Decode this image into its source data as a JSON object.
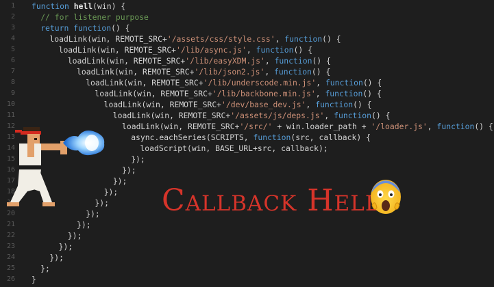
{
  "editor": {
    "lines": [
      {
        "n": "1",
        "indent": 0,
        "tokens": [
          {
            "c": "kw",
            "t": "function "
          },
          {
            "c": "fn",
            "t": "hell"
          },
          {
            "c": "pl",
            "t": "(win) {"
          }
        ]
      },
      {
        "n": "2",
        "indent": 1,
        "tokens": [
          {
            "c": "cm",
            "t": "// for listener purpose"
          }
        ]
      },
      {
        "n": "3",
        "indent": 1,
        "tokens": [
          {
            "c": "kw",
            "t": "return "
          },
          {
            "c": "kw",
            "t": "function"
          },
          {
            "c": "pl",
            "t": "() {"
          }
        ]
      },
      {
        "n": "4",
        "indent": 2,
        "tokens": [
          {
            "c": "pl",
            "t": "loadLink(win, REMOTE_SRC+"
          },
          {
            "c": "str",
            "t": "'/assets/css/style.css'"
          },
          {
            "c": "pl",
            "t": ", "
          },
          {
            "c": "kw",
            "t": "function"
          },
          {
            "c": "pl",
            "t": "() {"
          }
        ]
      },
      {
        "n": "5",
        "indent": 3,
        "tokens": [
          {
            "c": "pl",
            "t": "loadLink(win, REMOTE_SRC+"
          },
          {
            "c": "str",
            "t": "'/lib/async.js'"
          },
          {
            "c": "pl",
            "t": ", "
          },
          {
            "c": "kw",
            "t": "function"
          },
          {
            "c": "pl",
            "t": "() {"
          }
        ]
      },
      {
        "n": "6",
        "indent": 4,
        "tokens": [
          {
            "c": "pl",
            "t": "loadLink(win, REMOTE_SRC+"
          },
          {
            "c": "str",
            "t": "'/lib/easyXDM.js'"
          },
          {
            "c": "pl",
            "t": ", "
          },
          {
            "c": "kw",
            "t": "function"
          },
          {
            "c": "pl",
            "t": "() {"
          }
        ]
      },
      {
        "n": "7",
        "indent": 5,
        "tokens": [
          {
            "c": "pl",
            "t": "loadLink(win, REMOTE_SRC+"
          },
          {
            "c": "str",
            "t": "'/lib/json2.js'"
          },
          {
            "c": "pl",
            "t": ", "
          },
          {
            "c": "kw",
            "t": "function"
          },
          {
            "c": "pl",
            "t": "() {"
          }
        ]
      },
      {
        "n": "8",
        "indent": 6,
        "tokens": [
          {
            "c": "pl",
            "t": "loadLink(win, REMOTE_SRC+"
          },
          {
            "c": "str",
            "t": "'/lib/underscode.min.js'"
          },
          {
            "c": "pl",
            "t": ", "
          },
          {
            "c": "kw",
            "t": "function"
          },
          {
            "c": "pl",
            "t": "() {"
          }
        ]
      },
      {
        "n": "9",
        "indent": 7,
        "tokens": [
          {
            "c": "pl",
            "t": "loadLink(win, REMOTE_SRC+"
          },
          {
            "c": "str",
            "t": "'/lib/backbone.min.js'"
          },
          {
            "c": "pl",
            "t": ", "
          },
          {
            "c": "kw",
            "t": "function"
          },
          {
            "c": "pl",
            "t": "() {"
          }
        ]
      },
      {
        "n": "10",
        "indent": 8,
        "tokens": [
          {
            "c": "pl",
            "t": "loadLink(win, REMOTE_SRC+"
          },
          {
            "c": "str",
            "t": "'/dev/base_dev.js'"
          },
          {
            "c": "pl",
            "t": ", "
          },
          {
            "c": "kw",
            "t": "function"
          },
          {
            "c": "pl",
            "t": "() {"
          }
        ]
      },
      {
        "n": "11",
        "indent": 9,
        "tokens": [
          {
            "c": "pl",
            "t": "loadLink(win, REMOTE_SRC+"
          },
          {
            "c": "str",
            "t": "'/assets/js/deps.js'"
          },
          {
            "c": "pl",
            "t": ", "
          },
          {
            "c": "kw",
            "t": "function"
          },
          {
            "c": "pl",
            "t": "() {"
          }
        ]
      },
      {
        "n": "12",
        "indent": 10,
        "tokens": [
          {
            "c": "pl",
            "t": "loadLink(win, REMOTE_SRC+"
          },
          {
            "c": "str",
            "t": "'/src/'"
          },
          {
            "c": "pl",
            "t": " + win.loader_path + "
          },
          {
            "c": "str",
            "t": "'/loader.js'"
          },
          {
            "c": "pl",
            "t": ", "
          },
          {
            "c": "kw",
            "t": "function"
          },
          {
            "c": "pl",
            "t": "() {"
          }
        ]
      },
      {
        "n": "13",
        "indent": 11,
        "tokens": [
          {
            "c": "pl",
            "t": "async.eachSeries(SCRIPTS, "
          },
          {
            "c": "kw",
            "t": "function"
          },
          {
            "c": "pl",
            "t": "(src, callback) {"
          }
        ]
      },
      {
        "n": "14",
        "indent": 12,
        "tokens": [
          {
            "c": "pl",
            "t": "loadScript(win, BASE_URL+src, callback);"
          }
        ]
      },
      {
        "n": "15",
        "indent": 11,
        "tokens": [
          {
            "c": "pl",
            "t": "});"
          }
        ]
      },
      {
        "n": "16",
        "indent": 10,
        "tokens": [
          {
            "c": "pl",
            "t": "});"
          }
        ]
      },
      {
        "n": "17",
        "indent": 9,
        "tokens": [
          {
            "c": "pl",
            "t": "});"
          }
        ]
      },
      {
        "n": "18",
        "indent": 8,
        "tokens": [
          {
            "c": "pl",
            "t": "});"
          }
        ]
      },
      {
        "n": "19",
        "indent": 7,
        "tokens": [
          {
            "c": "pl",
            "t": "});"
          }
        ]
      },
      {
        "n": "20",
        "indent": 6,
        "tokens": [
          {
            "c": "pl",
            "t": "});"
          }
        ]
      },
      {
        "n": "21",
        "indent": 5,
        "tokens": [
          {
            "c": "pl",
            "t": "});"
          }
        ]
      },
      {
        "n": "22",
        "indent": 4,
        "tokens": [
          {
            "c": "pl",
            "t": "});"
          }
        ]
      },
      {
        "n": "23",
        "indent": 3,
        "tokens": [
          {
            "c": "pl",
            "t": "});"
          }
        ]
      },
      {
        "n": "24",
        "indent": 2,
        "tokens": [
          {
            "c": "pl",
            "t": "});"
          }
        ]
      },
      {
        "n": "25",
        "indent": 1,
        "tokens": [
          {
            "c": "pl",
            "t": "};"
          }
        ]
      },
      {
        "n": "26",
        "indent": 0,
        "tokens": [
          {
            "c": "pl",
            "t": "}"
          }
        ]
      }
    ]
  },
  "overlay": {
    "title": "Callback Hell",
    "emoji_icon": "screaming-face-emoji",
    "fighter_icon": "pixel-fighter-sprite",
    "fireball_icon": "hadouken-fireball"
  },
  "colors": {
    "background": "#1e1e1e",
    "keyword": "#569cd6",
    "string": "#ce9178",
    "comment": "#6a9955",
    "title": "#d6342a"
  }
}
